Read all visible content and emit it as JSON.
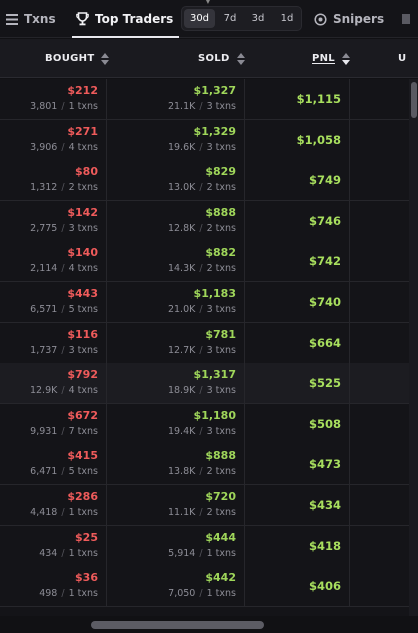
{
  "tabs": {
    "txns": "Txns",
    "top_traders": "Top Traders",
    "snipers": "Snipers",
    "periods": [
      "30d",
      "7d",
      "3d",
      "1d"
    ],
    "active_period": "30d"
  },
  "columns": {
    "bought": "BOUGHT",
    "sold": "SOLD",
    "pnl": "PNL",
    "u": "U"
  },
  "rows": [
    {
      "bought_usd": "$212",
      "bought_tokens": "3,801",
      "bought_txns": "1 txns",
      "sold_usd": "$1,327",
      "sold_tokens": "21.1K",
      "sold_txns": "3 txns",
      "pnl": "$1,115"
    },
    {
      "bought_usd": "$271",
      "bought_tokens": "3,906",
      "bought_txns": "4 txns",
      "sold_usd": "$1,329",
      "sold_tokens": "19.6K",
      "sold_txns": "3 txns",
      "pnl": "$1,058"
    },
    {
      "bought_usd": "$80",
      "bought_tokens": "1,312",
      "bought_txns": "2 txns",
      "sold_usd": "$829",
      "sold_tokens": "13.0K",
      "sold_txns": "2 txns",
      "pnl": "$749"
    },
    {
      "bought_usd": "$142",
      "bought_tokens": "2,775",
      "bought_txns": "3 txns",
      "sold_usd": "$888",
      "sold_tokens": "12.8K",
      "sold_txns": "2 txns",
      "pnl": "$746"
    },
    {
      "bought_usd": "$140",
      "bought_tokens": "2,114",
      "bought_txns": "4 txns",
      "sold_usd": "$882",
      "sold_tokens": "14.3K",
      "sold_txns": "2 txns",
      "pnl": "$742"
    },
    {
      "bought_usd": "$443",
      "bought_tokens": "6,571",
      "bought_txns": "5 txns",
      "sold_usd": "$1,183",
      "sold_tokens": "21.0K",
      "sold_txns": "3 txns",
      "pnl": "$740"
    },
    {
      "bought_usd": "$116",
      "bought_tokens": "1,737",
      "bought_txns": "3 txns",
      "sold_usd": "$781",
      "sold_tokens": "12.7K",
      "sold_txns": "3 txns",
      "pnl": "$664"
    },
    {
      "bought_usd": "$792",
      "bought_tokens": "12.9K",
      "bought_txns": "4 txns",
      "sold_usd": "$1,317",
      "sold_tokens": "18.9K",
      "sold_txns": "3 txns",
      "pnl": "$525"
    },
    {
      "bought_usd": "$672",
      "bought_tokens": "9,931",
      "bought_txns": "7 txns",
      "sold_usd": "$1,180",
      "sold_tokens": "19.4K",
      "sold_txns": "3 txns",
      "pnl": "$508"
    },
    {
      "bought_usd": "$415",
      "bought_tokens": "6,471",
      "bought_txns": "5 txns",
      "sold_usd": "$888",
      "sold_tokens": "13.8K",
      "sold_txns": "2 txns",
      "pnl": "$473"
    },
    {
      "bought_usd": "$286",
      "bought_tokens": "4,418",
      "bought_txns": "1 txns",
      "sold_usd": "$720",
      "sold_tokens": "11.1K",
      "sold_txns": "2 txns",
      "pnl": "$434"
    },
    {
      "bought_usd": "$25",
      "bought_tokens": "434",
      "bought_txns": "1 txns",
      "sold_usd": "$444",
      "sold_tokens": "5,914",
      "sold_txns": "1 txns",
      "pnl": "$418"
    },
    {
      "bought_usd": "$36",
      "bought_tokens": "498",
      "bought_txns": "1 txns",
      "sold_usd": "$442",
      "sold_tokens": "7,050",
      "sold_txns": "1 txns",
      "pnl": "$406"
    }
  ],
  "highlighted_row": 7,
  "colors": {
    "bought": "#ef5b5b",
    "sold": "#9fd65a",
    "pnl": "#a8df5e",
    "background": "#111114"
  }
}
